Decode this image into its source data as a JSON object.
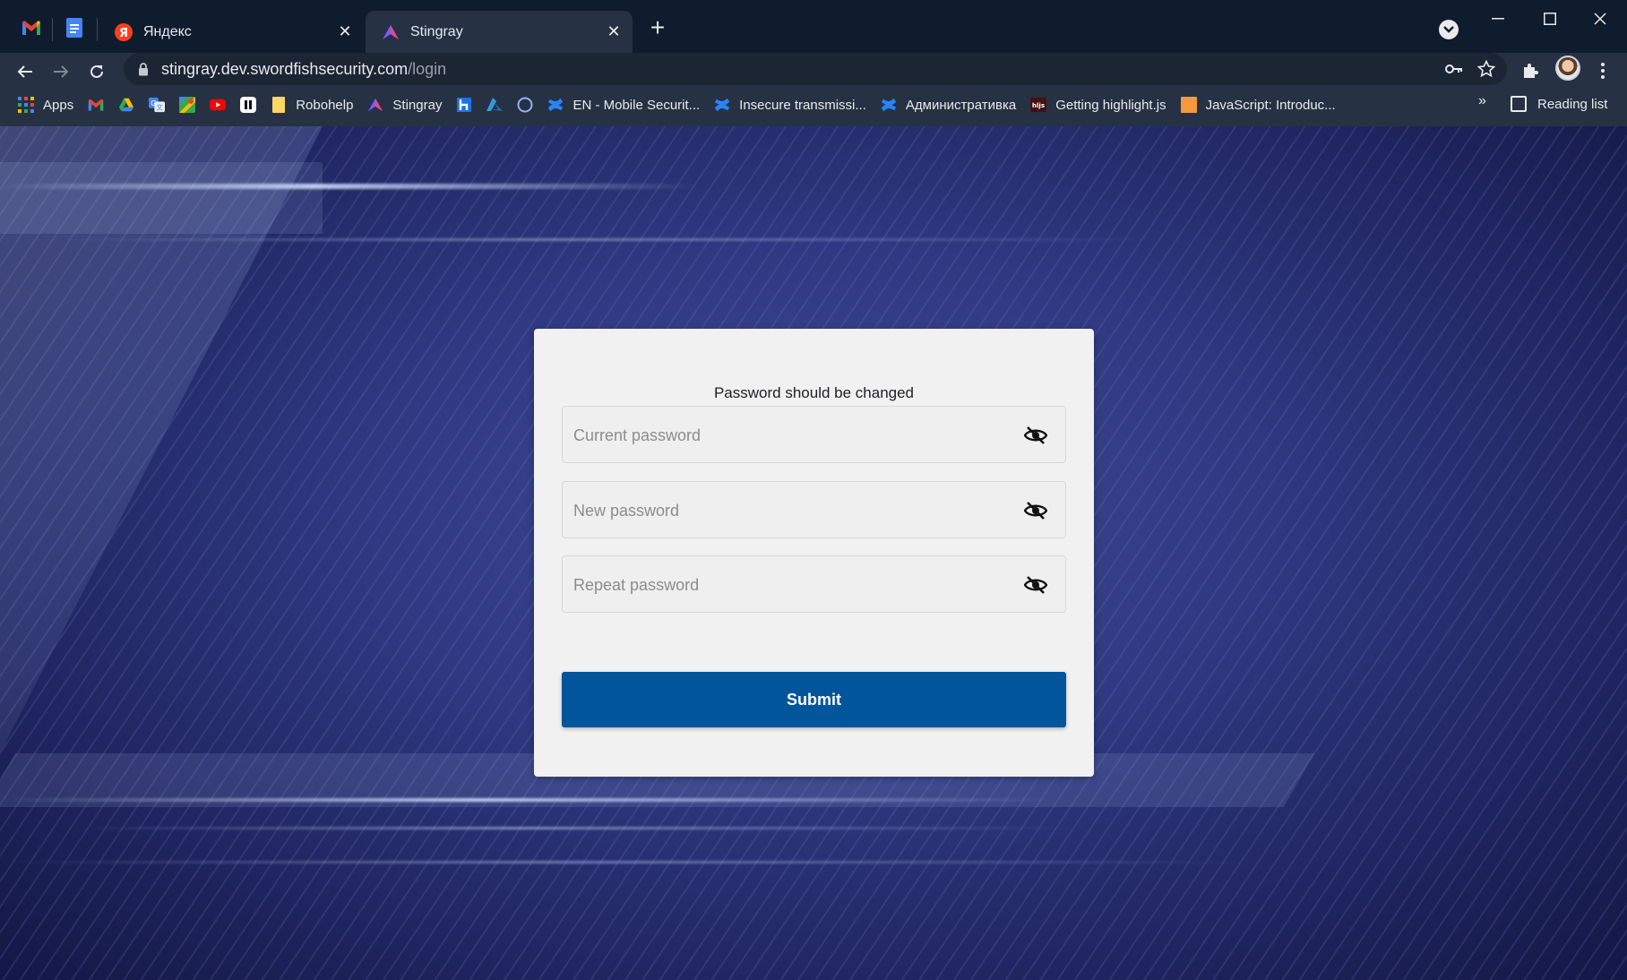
{
  "browser": {
    "pinned_tabs": [
      {
        "name": "gmail-tab",
        "icon": "gmail-icon"
      },
      {
        "name": "docs-tab",
        "icon": "google-docs-icon"
      }
    ],
    "tabs": [
      {
        "title": "Яндекс",
        "icon": "yandex-icon",
        "active": false
      },
      {
        "title": "Stingray",
        "icon": "stingray-icon",
        "active": true
      }
    ],
    "address": {
      "host": "stingray.dev.swordfishsecurity.com",
      "path": "/login"
    },
    "bookmarks": [
      {
        "label": "Apps",
        "icon": "apps-grid-icon"
      },
      {
        "label": "",
        "icon": "gmail-icon"
      },
      {
        "label": "",
        "icon": "google-drive-icon"
      },
      {
        "label": "",
        "icon": "google-translate-icon"
      },
      {
        "label": "",
        "icon": "google-maps-icon"
      },
      {
        "label": "",
        "icon": "youtube-icon"
      },
      {
        "label": "",
        "icon": "pause-app-icon"
      },
      {
        "label": "Robohelp",
        "icon": "folder-icon"
      },
      {
        "label": "Stingray",
        "icon": "stingray-icon"
      },
      {
        "label": "",
        "icon": "h-app-icon"
      },
      {
        "label": "",
        "icon": "azure-icon"
      },
      {
        "label": "",
        "icon": "circle-icon"
      },
      {
        "label": "EN - Mobile Securit...",
        "icon": "confluence-icon"
      },
      {
        "label": "Insecure transmissi...",
        "icon": "confluence-icon"
      },
      {
        "label": "Административка",
        "icon": "confluence-icon"
      },
      {
        "label": "Getting highlight.js",
        "icon": "hljs-icon"
      },
      {
        "label": "JavaScript: Introduc...",
        "icon": "orange-square-icon"
      }
    ],
    "bookmarks_overflow": "»",
    "reading_list": "Reading list"
  },
  "login_form": {
    "title": "Password should be changed",
    "fields": [
      {
        "placeholder": "Current password",
        "value": ""
      },
      {
        "placeholder": "New password",
        "value": ""
      },
      {
        "placeholder": "Repeat password",
        "value": ""
      }
    ],
    "submit_label": "Submit"
  },
  "colors": {
    "submit": "#00559b",
    "card": "#f1f1f1",
    "page_bg": "#2f3880",
    "chrome_dark": "#0f1c2d",
    "chrome_toolbar": "#263243"
  }
}
